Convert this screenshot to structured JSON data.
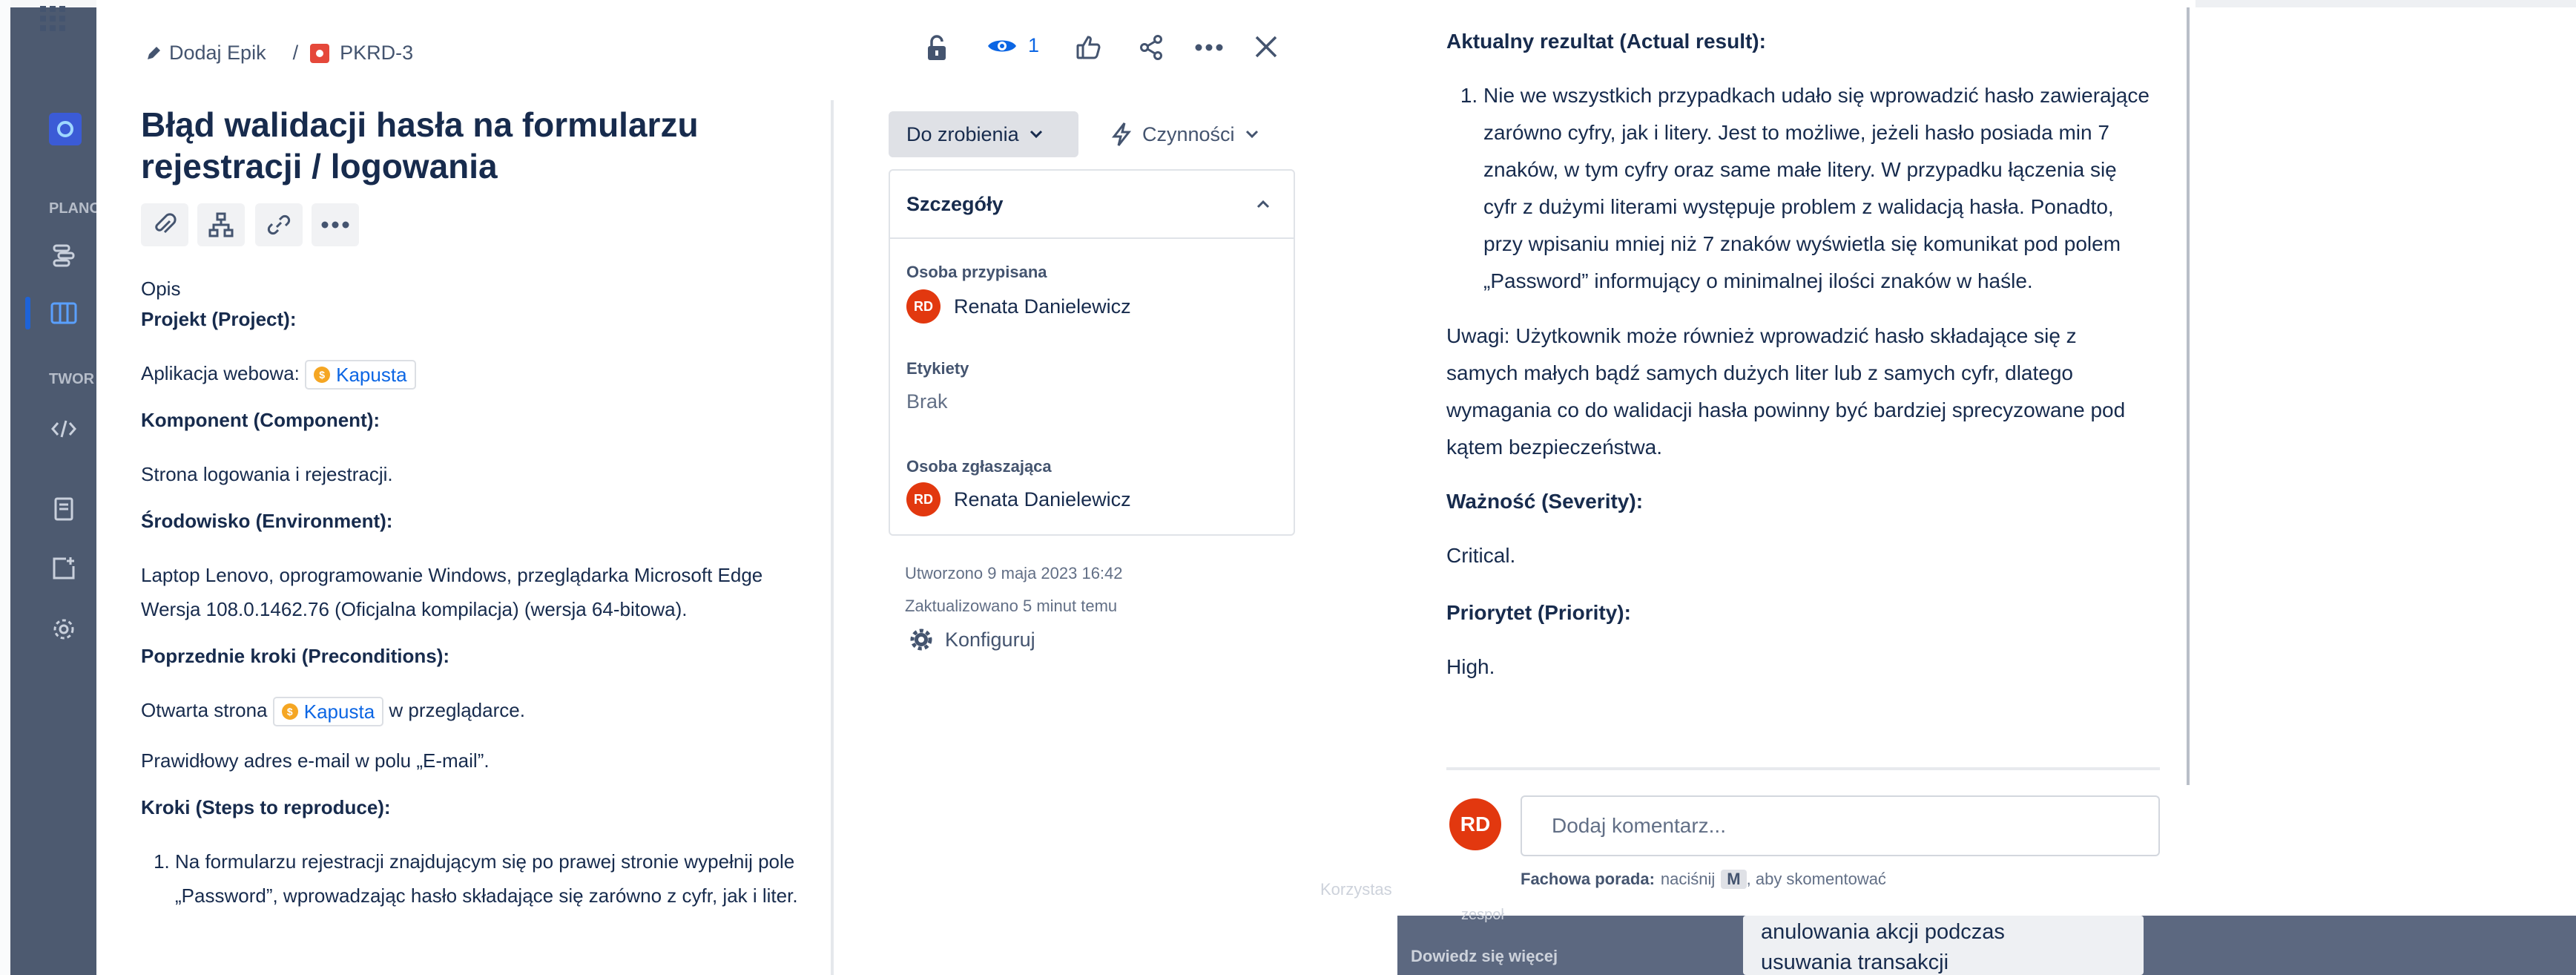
{
  "header": {
    "breadcrumb_epic": "Dodaj Epik",
    "breadcrumb_sep": "/",
    "issue_key": "PKRD-3",
    "watchers_count": "1"
  },
  "issue": {
    "title": "Błąd walidacji hasła na formularzu rejestracji / logowania"
  },
  "description": {
    "label": "Opis",
    "project_heading": "Projekt (Project):",
    "project_text": "Aplikacja webowa:",
    "project_chip": "Kapusta",
    "component_heading": "Komponent (Component):",
    "component_text": "Strona logowania i rejestracji.",
    "environment_heading": "Środowisko (Environment):",
    "environment_text": "Laptop Lenovo, oprogramowanie Windows, przeglądarka Microsoft Edge Wersja 108.0.1462.76 (Oficjalna kompilacja) (wersja 64-bitowa).",
    "preconditions_heading": "Poprzednie kroki (Preconditions):",
    "precondition1_before": "Otwarta strona",
    "precondition1_chip": "Kapusta",
    "precondition1_after": "w przeglądarce.",
    "precondition2": "Prawidłowy adres e-mail w polu „E-mail”.",
    "steps_heading": "Kroki (Steps to reproduce):",
    "step1": "Na formularzu rejestracji znajdującym się po prawej stronie wypełnij pole „Password”, wprowadzając hasło składające się zarówno z cyfr, jak i liter."
  },
  "sidebar": {
    "status_label": "Do zrobienia",
    "actions_label": "Czynności",
    "details_title": "Szczegóły",
    "assignee_label": "Osoba przypisana",
    "assignee_initials": "RD",
    "assignee_name": "Renata Danielewicz",
    "labels_label": "Etykiety",
    "labels_value": "Brak",
    "reporter_label": "Osoba zgłaszająca",
    "reporter_initials": "RD",
    "reporter_name": "Renata Danielewicz",
    "created": "Utworzono 9 maja 2023 16:42",
    "updated": "Zaktualizowano 5 minut temu",
    "configure": "Konfiguruj"
  },
  "right_panel": {
    "actual_result_heading": "Aktualny rezultat (Actual result):",
    "actual_result_item": "Nie we wszystkich przypadkach udało się wprowadzić hasło zawierające zarówno cyfry, jak i litery. Jest to możliwe, jeżeli hasło posiada min 7 znaków, w tym cyfry oraz same małe litery. W przypadku łączenia się cyfr z dużymi literami występuje problem z walidacją hasła. Ponadto, przy wpisaniu mniej niż 7 znaków wyświetla się komunikat pod polem „Password” informujący o minimalnej ilości znaków w haśle.",
    "notes": "Uwagi: Użytkownik może również wprowadzić hasło składające się z samych małych bądź samych dużych liter lub z samych cyfr, dlatego wymagania co do walidacji hasła powinny być bardziej sprecyzowane pod kątem bezpieczeństwa.",
    "severity_heading": "Ważność (Severity):",
    "severity_value": "Critical.",
    "priority_heading": "Priorytet (Priority):",
    "priority_value": "High."
  },
  "comment": {
    "avatar_initials": "RD",
    "placeholder": "Dodaj komentarz...",
    "tip_bold": "Fachowa porada:",
    "tip_pre": "naciśnij",
    "tip_key": "M",
    "tip_post": ", aby skomentować"
  },
  "background": {
    "nav_label_plan": "PLANO",
    "nav_label_twor": "TWOR",
    "text_korzysta": "Korzystas",
    "text_zespol": "zespoł",
    "text_dowiedz": "Dowiedz się więcej",
    "card_line1": "anulowania akcji podczas",
    "card_line2": "usuwania transakcji"
  },
  "colors": {
    "accent": "#0c66e4",
    "avatar": "#e2380f",
    "bug_icon": "#e5483a",
    "background_overlay": "#5c6880"
  },
  "icons": [
    "apps-grid-icon",
    "pencil-icon",
    "bug-icon",
    "lock-icon",
    "eye-icon",
    "thumbs-up-icon",
    "share-icon",
    "more-icon",
    "close-icon",
    "attachment-icon",
    "hierarchy-icon",
    "link-icon",
    "chevron-down-icon",
    "lightning-icon",
    "chevron-up-icon",
    "gear-icon"
  ]
}
